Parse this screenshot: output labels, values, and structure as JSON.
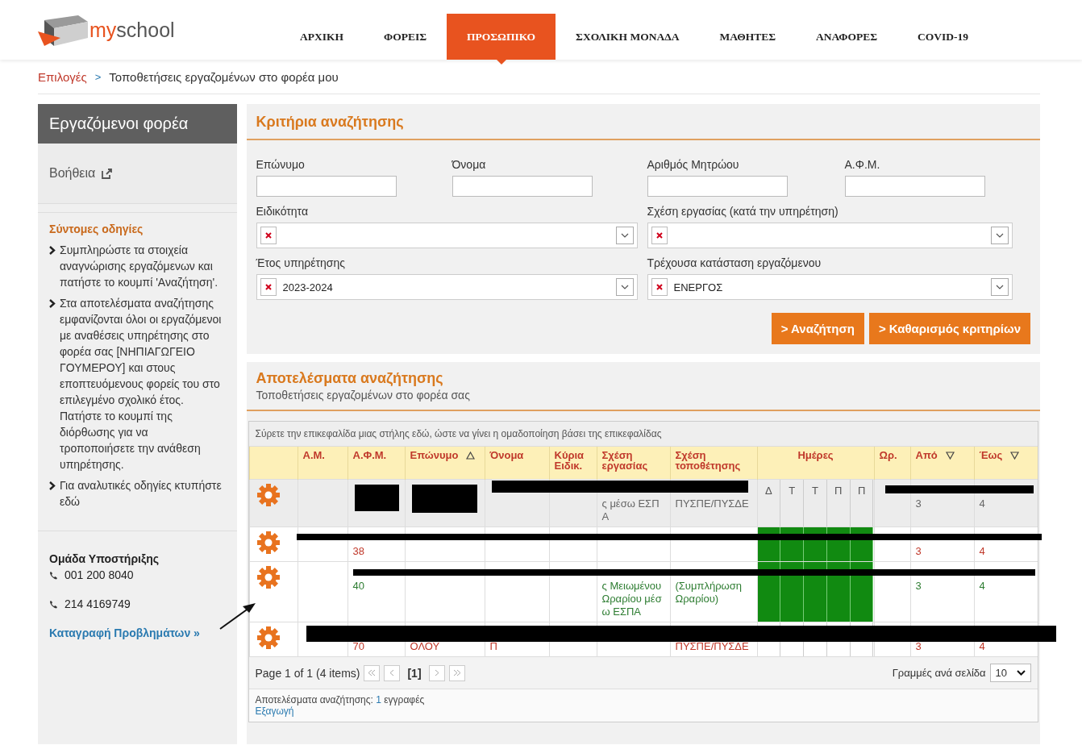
{
  "header": {
    "logo": {
      "first": "my",
      "second": "school"
    },
    "nav": [
      {
        "label": "ΑΡΧΙΚΗ",
        "selected": false
      },
      {
        "label": "ΦΟΡΕΙΣ",
        "selected": false
      },
      {
        "label": "ΠΡΟΣΩΠΙΚΟ",
        "selected": true
      },
      {
        "label": "ΣΧΟΛΙΚΗ ΜΟΝΑΔΑ",
        "selected": false
      },
      {
        "label": "ΜΑΘΗΤΕΣ",
        "selected": false
      },
      {
        "label": "ΑΝΑΦΟΡΕΣ",
        "selected": false
      },
      {
        "label": "COVID-19",
        "selected": false
      }
    ]
  },
  "breadcrumb": {
    "link": "Επιλογές",
    "separator": ">",
    "current": "Τοποθετήσεις εργαζομένων στο φορέα μου"
  },
  "sidebar": {
    "title": "Εργαζόμενοι φορέα",
    "help": "Βοήθεια",
    "tips_title": "Σύντομες οδηγίες",
    "tips": [
      "Συμπληρώστε τα στοιχεία αναγνώρισης εργαζόμενων και πατήστε το κουμπί 'Αναζήτηση'.",
      "Στα αποτελέσματα αναζήτησης εμφανίζονται όλοι οι εργαζόμενοι με αναθέσεις υπηρέτησης στο φορέα σας [ΝΗΠΙΑΓΩΓΕΙΟ ΓΟΥΜΕΡΟΥ] και στους εποπτευόμενους φορείς του στο επιλεγμένο σχολικό έτος. Πατήστε το κουμπί της διόρθωσης για να τροποποιήσετε την ανάθεση υπηρέτησης.",
      "Για αναλυτικές οδηγίες κτυπήστε εδώ"
    ],
    "support": {
      "title": "Ομάδα Υποστήριξης",
      "phones": [
        "001 200 8040",
        "214 4169749"
      ],
      "link": "Καταγραφή Προβλημάτων »"
    }
  },
  "criteria": {
    "title": "Κριτήρια αναζήτησης",
    "fields": [
      {
        "kind": "text",
        "label": "Επώνυμο"
      },
      {
        "kind": "text",
        "label": "Όνομα"
      },
      {
        "kind": "text",
        "label": "Αριθμός Μητρώου"
      },
      {
        "kind": "text",
        "label": "Α.Φ.Μ."
      },
      {
        "kind": "select",
        "label": "Ειδικότητα"
      },
      {
        "kind": "select",
        "label": "Σχέση εργασίας (κατά την υπηρέτηση)"
      },
      {
        "kind": "select",
        "label": "Έτος υπηρέτησης",
        "value": "2023-2024"
      },
      {
        "kind": "select",
        "label": "Τρέχουσα κατάσταση εργαζόμενου",
        "value": "ΕΝΕΡΓΟΣ"
      }
    ],
    "buttons": [
      "> Αναζήτηση",
      "> Καθαρισμός κριτηρίων"
    ]
  },
  "results": {
    "title": "Αποτελέσματα αναζήτησης",
    "subtitle": "Τοποθετήσεις εργαζομένων στο φορέα σας",
    "group_hint": "Σύρετε την επικεφαλίδα μιας στήλης εδώ, ώστε να γίνει η ομαδοποίηση βάσει της επικεφαλίδας",
    "columns": [
      {
        "kind": "text",
        "label": "Α.Μ."
      },
      {
        "kind": "text",
        "label": "Α.Φ.Μ."
      },
      {
        "kind": "text",
        "label": "Επώνυμο",
        "sorted_ascending": true
      },
      {
        "kind": "text",
        "label": "Όνομα"
      },
      {
        "kind": "text",
        "label": "Κύρια Ειδικ."
      },
      {
        "kind": "text",
        "label": "Σχέση εργασίας"
      },
      {
        "kind": "text",
        "label": "Σχέση τοποθέτησης"
      },
      {
        "kind": "days",
        "label": "Ημέρες"
      },
      {
        "kind": "text",
        "label": "Ωρ."
      },
      {
        "kind": "text",
        "label": "Από",
        "filterable": true
      },
      {
        "kind": "text",
        "label": "Έως",
        "filterable": true
      }
    ],
    "rows": [
      {
        "color": "#666666",
        "shaded": true,
        "days_active": false,
        "days": [
          "Δ",
          "Τ",
          "Τ",
          "Π",
          "Π"
        ],
        "cells": [
          "",
          "",
          "",
          "",
          "",
          "ς μέσω ΕΣΠΑ",
          "ΠΥΣΠΕ/ΠΥΣΔΕ",
          "",
          "",
          "3",
          "4"
        ]
      },
      {
        "color": "#c0392b",
        "shaded": false,
        "days_active": true,
        "cells": [
          "",
          "38",
          "",
          "",
          "",
          "",
          "",
          "",
          "",
          "3",
          "4"
        ]
      },
      {
        "color": "#2e7d32",
        "shaded": false,
        "days_active": true,
        "cells": [
          "",
          "40",
          "",
          "",
          "",
          "ς Μειωμένου Ωραρίου μέσω ΕΣΠΑ",
          "(Συμπλήρωση Ωραρίου)",
          "",
          "",
          "3",
          "4"
        ]
      },
      {
        "color": "#c0392b",
        "shaded": false,
        "days_active": false,
        "cells": [
          "",
          "70",
          "ΟΛΟΥ",
          "Π",
          "",
          "",
          "ΠΥΣΠΕ/ΠΥΣΔΕ",
          "",
          "",
          "3",
          "4"
        ]
      }
    ],
    "pager": {
      "info": "Page 1 of 1 (4 items)",
      "current": "[1]",
      "page_size_label": "Γραμμές ανά σελίδα",
      "page_size": "10"
    },
    "summary": {
      "label": "Αποτελέσματα αναζήτησης:",
      "count": "1",
      "unit": "εγγραφές"
    },
    "export": "Εξαγωγή"
  }
}
